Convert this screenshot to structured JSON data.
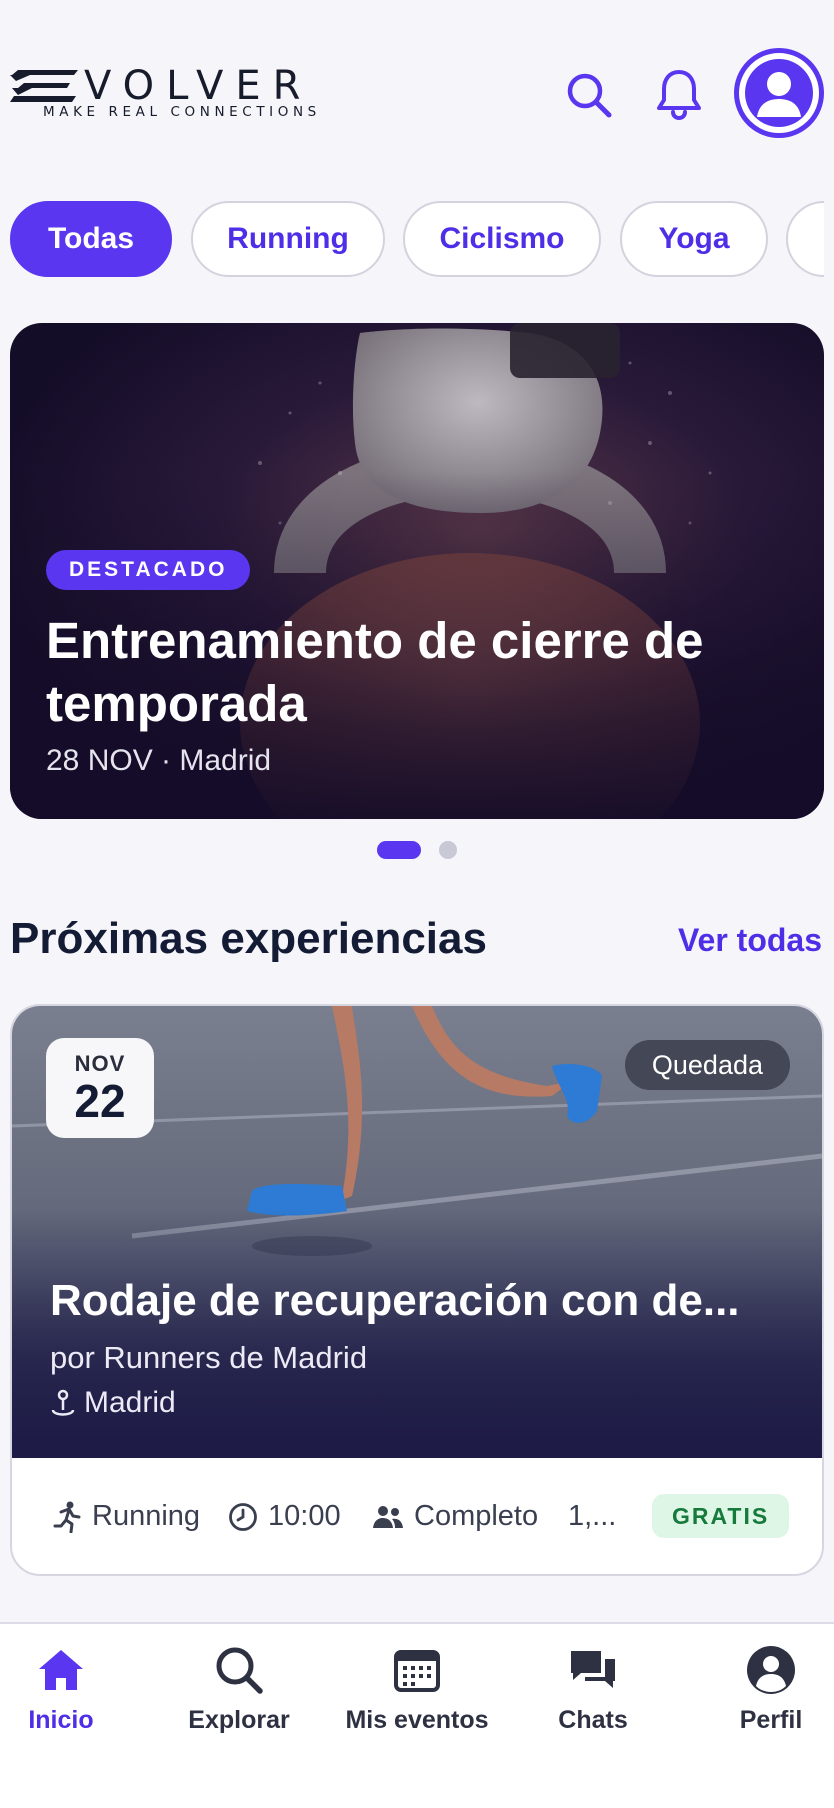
{
  "brand": {
    "name": "VOLVER",
    "tagline": "MAKE REAL CONNECTIONS"
  },
  "header": {
    "icons": [
      "search-icon",
      "bell-icon",
      "user-avatar-icon"
    ]
  },
  "colors": {
    "accent": "#5a36f0",
    "text": "#141b34",
    "price_bg": "#def6e6",
    "price_text": "#177a3d"
  },
  "filters": {
    "chips": [
      {
        "label": "Todas",
        "active": true
      },
      {
        "label": "Running",
        "active": false
      },
      {
        "label": "Ciclismo",
        "active": false
      },
      {
        "label": "Yoga",
        "active": false
      }
    ]
  },
  "featured": {
    "badge": "DESTACADO",
    "title": "Entrenamiento de cierre de temporada",
    "meta": "28 NOV · Madrid",
    "carousel": {
      "pages": 2,
      "current": 1
    }
  },
  "section": {
    "title": "Próximas experiencias",
    "see_all": "Ver todas"
  },
  "event": {
    "month": "NOV",
    "day": "22",
    "type": "Quedada",
    "title": "Rodaje de recuperación con de...",
    "organizer": "por Runners de Madrid",
    "location": "Madrid",
    "sport": "Running",
    "time": "10:00",
    "capacity": "Completo",
    "distance": "1,...",
    "price": "GRATIS"
  },
  "nav": {
    "items": [
      {
        "label": "Inicio",
        "icon": "home-icon",
        "active": true
      },
      {
        "label": "Explorar",
        "icon": "search-icon",
        "active": false
      },
      {
        "label": "Mis eventos",
        "icon": "calendar-icon",
        "active": false
      },
      {
        "label": "Chats",
        "icon": "chat-icon",
        "active": false
      },
      {
        "label": "Perfil",
        "icon": "profile-icon",
        "active": false
      }
    ]
  }
}
